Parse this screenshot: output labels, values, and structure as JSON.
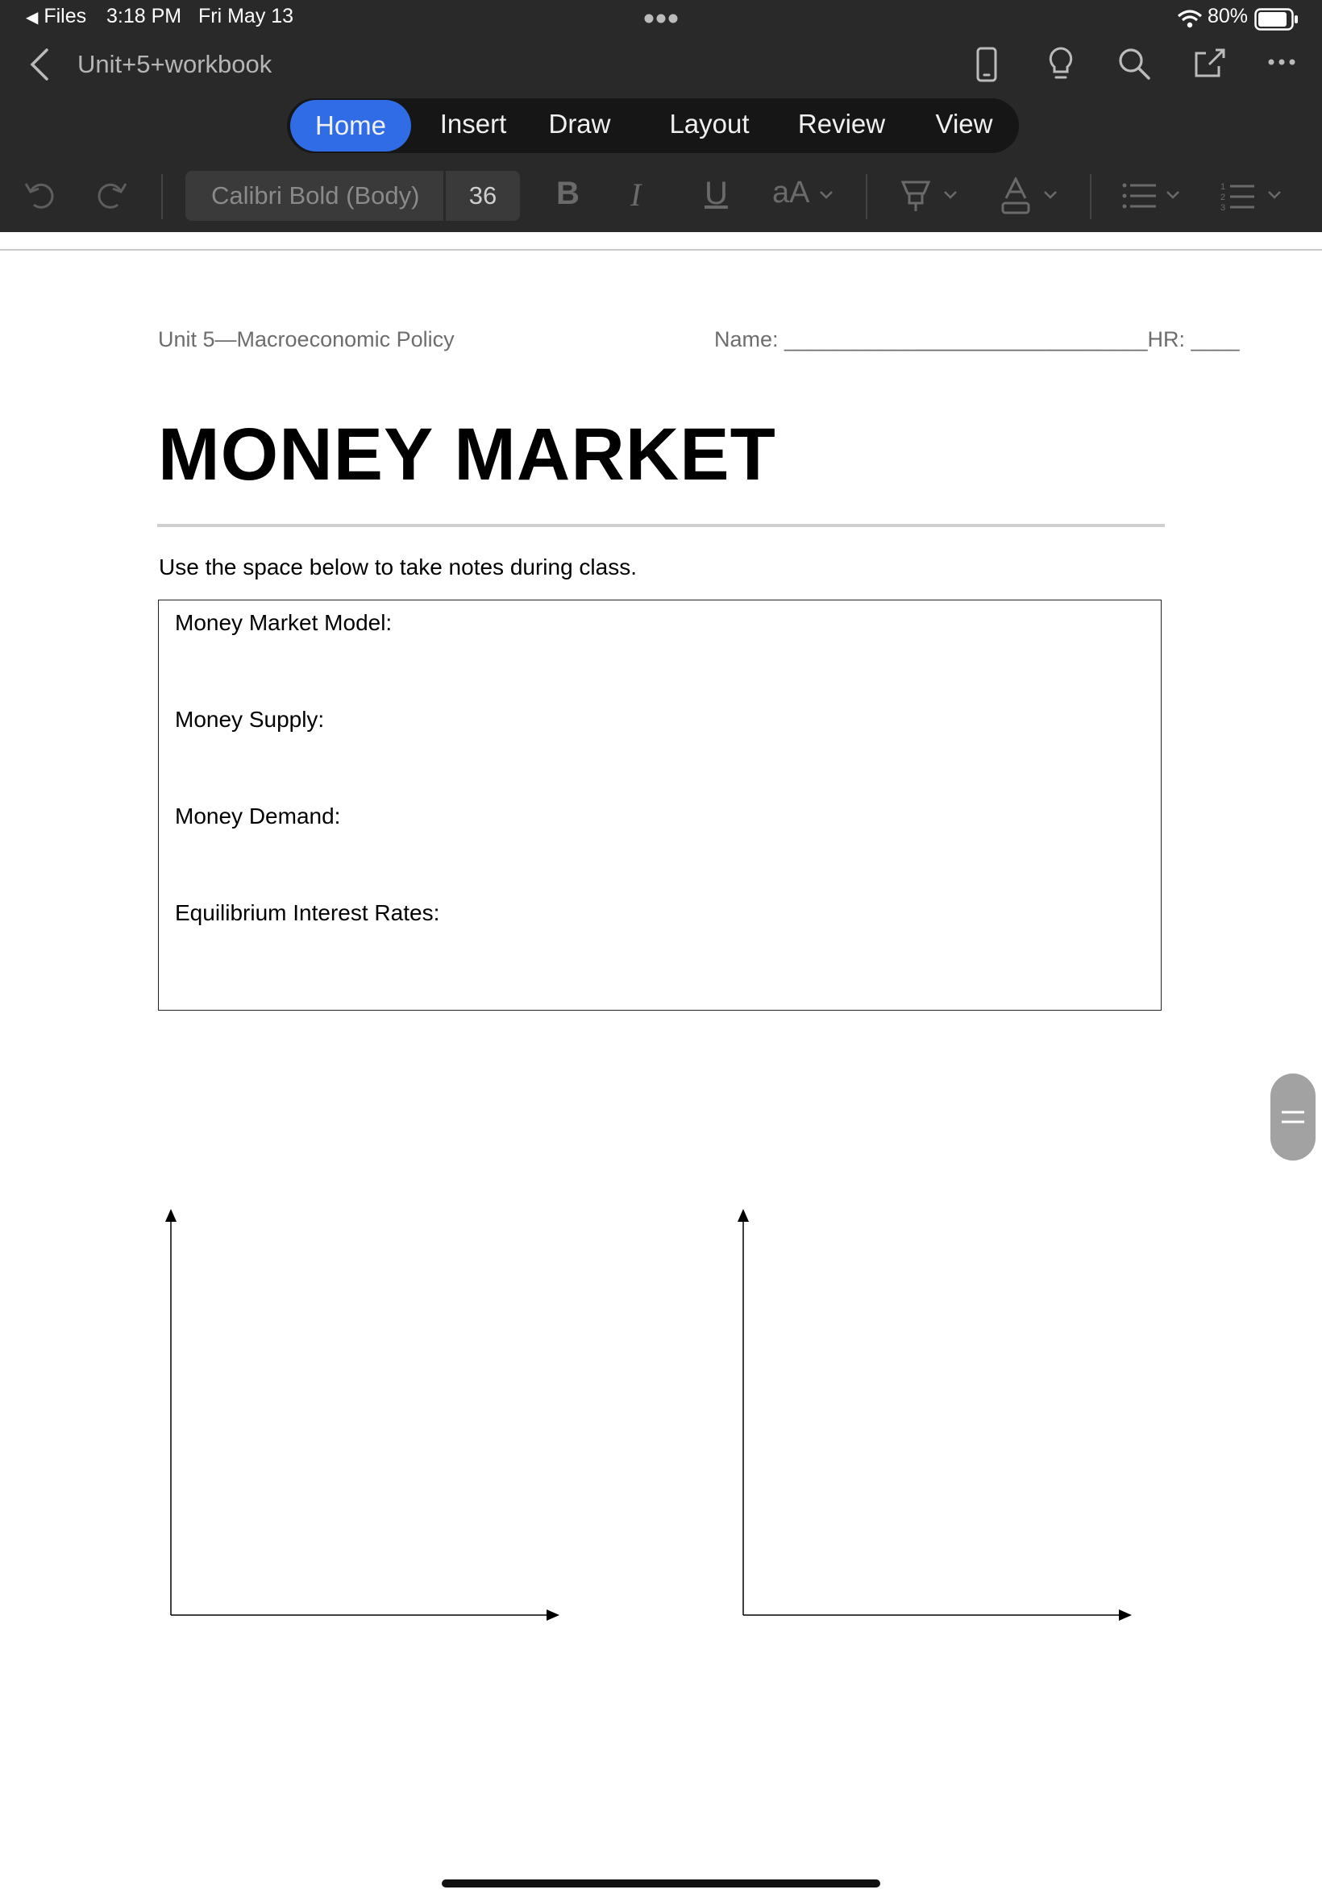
{
  "status_bar": {
    "back_app": "Files",
    "time": "3:18 PM",
    "date": "Fri May 13",
    "battery": "80%"
  },
  "app_bar": {
    "document_title": "Unit+5+workbook"
  },
  "ribbon": {
    "tabs": [
      {
        "label": "Home",
        "active": true
      },
      {
        "label": "Insert",
        "active": false
      },
      {
        "label": "Draw",
        "active": false
      },
      {
        "label": "Layout",
        "active": false
      },
      {
        "label": "Review",
        "active": false
      },
      {
        "label": "View",
        "active": false
      }
    ],
    "font_name": "Calibri Bold (Body)",
    "font_size": "36",
    "bold_label": "B",
    "italic_label": "I",
    "underline_label": "U",
    "text_size_label": "aA",
    "accent_color": "#2f6ce5"
  },
  "document": {
    "header_left": "Unit 5—Macroeconomic Policy",
    "header_name": "Name: ______________________________HR: ____",
    "title": "MONEY MARKET",
    "instructions": "Use the space below to take notes during class.",
    "note_labels": [
      "Money Market Model:",
      "Money Supply:",
      "Money Demand:",
      "Equilibrium Interest Rates:"
    ]
  },
  "icons": {
    "back": "chevron-left-icon",
    "device": "phone-icon",
    "ideas": "lightbulb-icon",
    "search": "search-icon",
    "share": "share-icon",
    "more": "more-icon"
  }
}
